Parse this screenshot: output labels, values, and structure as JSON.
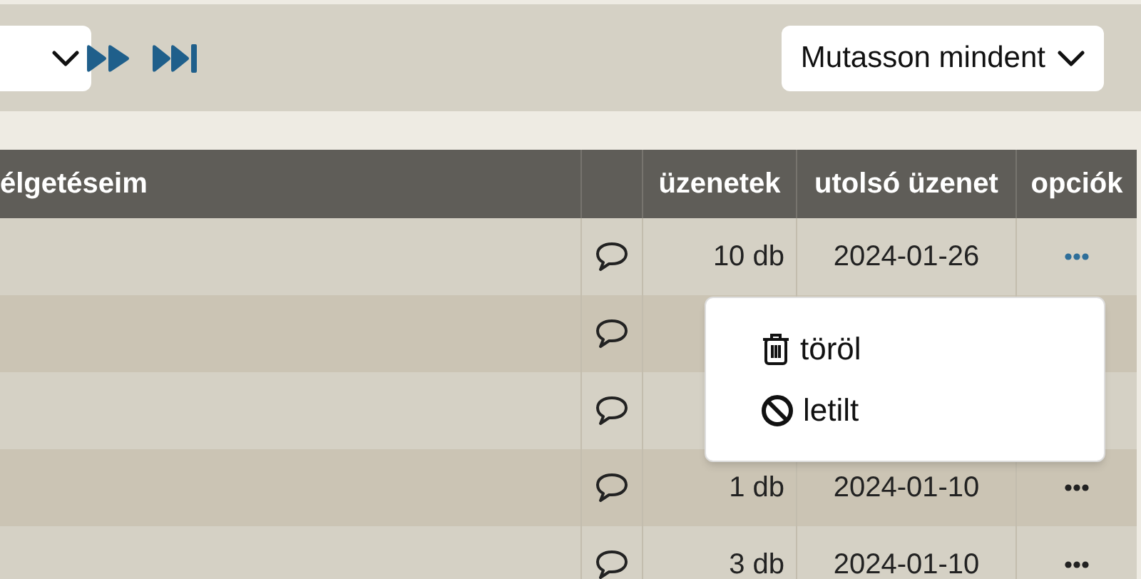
{
  "toolbar": {
    "sort_select": {
      "label": "Mutasson mindent"
    }
  },
  "table": {
    "columns": [
      "élgetéseim",
      "üzenetek",
      "utolsó üzenet",
      "opciók"
    ],
    "rows": [
      {
        "messages": "10 db",
        "last_message": "2024-01-26",
        "menu_open": true
      },
      {
        "menu_open": false
      },
      {
        "menu_open": false
      },
      {
        "messages": "1 db",
        "last_message": "2024-01-10",
        "menu_open": false
      },
      {
        "messages": "3 db",
        "last_message": "2024-01-10",
        "menu_open": false
      }
    ]
  },
  "row_menu": {
    "items": [
      {
        "kind": "delete",
        "label": "töröl"
      },
      {
        "kind": "block",
        "label": "letilt"
      }
    ]
  }
}
